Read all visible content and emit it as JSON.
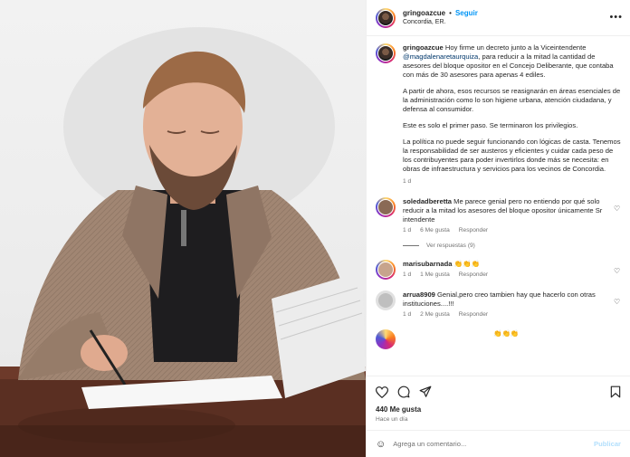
{
  "post": {
    "username": "gringoazcue",
    "dot": "•",
    "follow_label": "Seguir",
    "location": "Concordia, ER.",
    "more_icon": "more-horizontal-icon",
    "caption": {
      "intro": "Hoy firme un decreto junto a la Viceintendente",
      "mention": "@magdalenaretaurquiza",
      "rest": ", para reducir a la mitad la cantidad de asesores del bloque opositor en el Concejo Deliberante, que contaba con más de 30 asesores para apenas 4 ediles.",
      "p2": "A partir de ahora, esos recursos se reasignarán en áreas esenciales de la administración como lo son higiene urbana, atención ciudadana, y defensa al consumidor.",
      "p3": "Este es solo el primer paso. Se terminaron los privilegios.",
      "p4": "La política no puede seguir funcionando con lógicas de casta. Tenemos la responsabilidad de ser austeros y eficientes y cuidar cada peso de los contribuyentes para poder invertirlos donde más se necesita: en obras de infraestructura y servicios para los vecinos de Concordia.",
      "time": "1 d"
    },
    "likes": "440 Me gusta",
    "ago": "Hace un día"
  },
  "comments": [
    {
      "username": "soledadberetta",
      "text": "Me parece genial pero no entiendo por qué solo reducir a la mitad los asesores del bloque opositor únicamente Sr intendente",
      "time": "1 d",
      "likes": "6 Me gusta",
      "reply": "Responder",
      "view_replies": "Ver respuestas (9)"
    },
    {
      "username": "marisubarnada",
      "text": "👏👏👏",
      "time": "1 d",
      "likes": "1 Me gusta",
      "reply": "Responder"
    },
    {
      "username": "arrua8909",
      "text": "Genial,pero creo tambien hay que hacerlo con otras instituciones....!!!",
      "time": "1 d",
      "likes": "2 Me gusta",
      "reply": "Responder"
    }
  ],
  "partial_comment": {
    "text": "👏👏👏"
  },
  "composer": {
    "placeholder": "Agrega un comentario...",
    "publish_label": "Publicar",
    "emoji_icon": "smiley-icon"
  },
  "actions": {
    "like_icon": "heart-icon",
    "comment_icon": "comment-icon",
    "share_icon": "share-icon",
    "save_icon": "bookmark-icon"
  }
}
